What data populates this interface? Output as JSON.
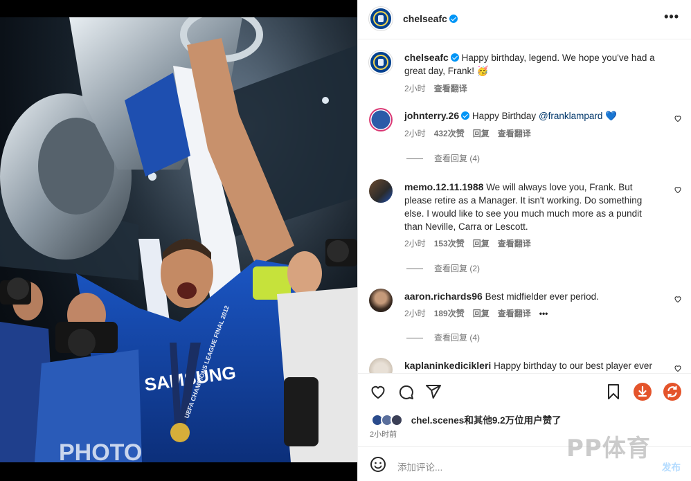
{
  "post": {
    "username": "chelseafc",
    "more_icon": "more-horizontal-icon"
  },
  "caption": {
    "username": "chelseafc",
    "text": "Happy birthday, legend. We hope you've had a great day, Frank! 🥳",
    "time": "2小时",
    "translate": "查看翻译"
  },
  "comments": [
    {
      "username": "johnterry.26",
      "verified": true,
      "text": "Happy Birthday",
      "mention": "@franklampard",
      "emoji": "💙",
      "time": "2小时",
      "likes": "432次赞",
      "reply": "回复",
      "translate": "查看翻译",
      "view_replies": "查看回复 (4)"
    },
    {
      "username": "memo.12.11.1988",
      "verified": false,
      "text": "We will always love you, Frank. But please retire as a Manager. It isn't working. Do something else. I would like to see you much much more as a pundit than Neville, Carra or Lescott.",
      "time": "2小时",
      "likes": "153次赞",
      "reply": "回复",
      "translate": "查看翻译",
      "view_replies": "查看回复 (2)"
    },
    {
      "username": "aaron.richards96",
      "verified": false,
      "text": "Best midfielder ever period.",
      "time": "2小时",
      "likes": "189次赞",
      "reply": "回复",
      "translate": "查看翻译",
      "extra": "•••",
      "view_replies": "查看回复 (4)"
    },
    {
      "username": "kaplaninkedicikleri",
      "verified": false,
      "text": "Happy birthday to our best player ever"
    }
  ],
  "likes": {
    "user": "chel.scenes",
    "text": "和其他9.2万位用户赞了"
  },
  "post_time": "2小时前",
  "add_comment": {
    "placeholder": "添加评论...",
    "post_label": "发布"
  },
  "watermark": "PP体育",
  "photo_text": {
    "shirt_sponsor": "SAMSUNG",
    "medal_ribbon": "UEFA CHAMPIONS LEAGUE FINAL 2012",
    "photo_vest": "PHOTO"
  },
  "icons": [
    "heart-icon",
    "comment-icon",
    "share-icon",
    "bookmark-icon",
    "download-icon",
    "refresh-icon",
    "emoji-icon"
  ],
  "colors": {
    "accent": "#0095f6",
    "chelsea_blue": "#03418f",
    "orange": "#e4542b"
  }
}
